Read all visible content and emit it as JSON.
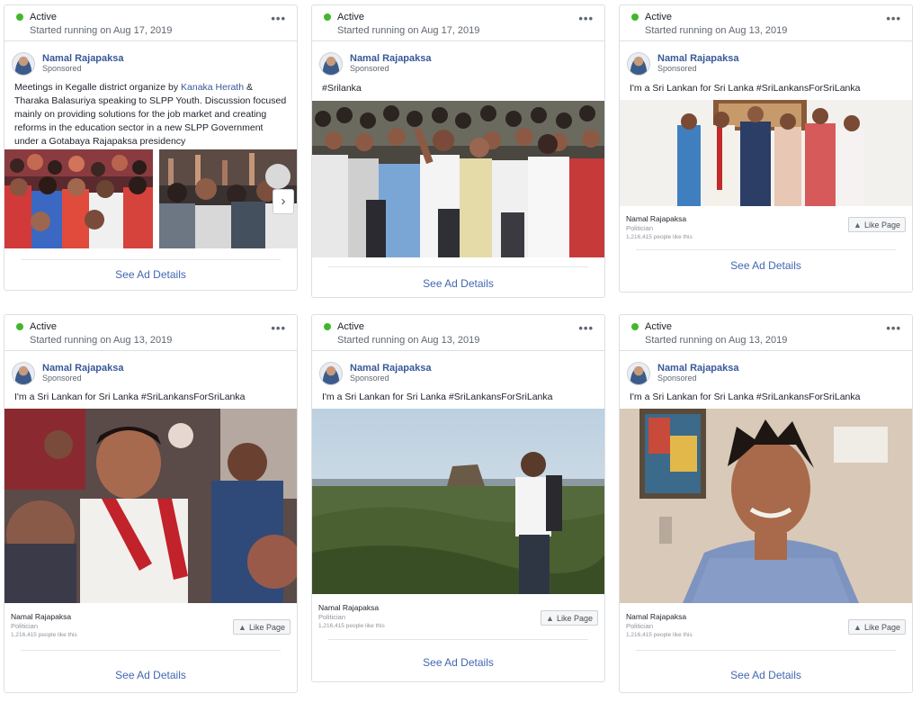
{
  "cards": [
    {
      "status": "Active",
      "started": "Started running on Aug 17, 2019",
      "poster": "Namal Rajapaksa",
      "sponsored": "Sponsored",
      "text_parts": [
        "Meetings in Kegalle district organize by ",
        "Kanaka Herath",
        " & Tharaka Balasuriya speaking to SLPP Youth. Discussion focused mainly on providing solutions for the job market and creating reforms in the education sector in a new SLPP Government under a Gotabaya Rajapaksa presidency"
      ],
      "see_details": "See Ad Details"
    },
    {
      "status": "Active",
      "started": "Started running on Aug 17, 2019",
      "poster": "Namal Rajapaksa",
      "sponsored": "Sponsored",
      "text": "#Srilanka",
      "see_details": "See Ad Details"
    },
    {
      "status": "Active",
      "started": "Started running on Aug 13, 2019",
      "poster": "Namal Rajapaksa",
      "sponsored": "Sponsored",
      "text": "I'm a Sri Lankan for Sri Lanka #SriLankansForSriLanka",
      "page_name": "Namal Rajapaksa",
      "page_category": "Politician",
      "page_likes": "1,216,415 people like this",
      "like_label": "Like Page",
      "see_details": "See Ad Details"
    },
    {
      "status": "Active",
      "started": "Started running on Aug 13, 2019",
      "poster": "Namal Rajapaksa",
      "sponsored": "Sponsored",
      "text": "I'm a Sri Lankan for Sri Lanka #SriLankansForSriLanka",
      "page_name": "Namal Rajapaksa",
      "page_category": "Politician",
      "page_likes": "1,216,415 people like this",
      "like_label": "Like Page",
      "see_details": "See Ad Details"
    },
    {
      "status": "Active",
      "started": "Started running on Aug 13, 2019",
      "poster": "Namal Rajapaksa",
      "sponsored": "Sponsored",
      "text": "I'm a Sri Lankan for Sri Lanka #SriLankansForSriLanka",
      "page_name": "Namal Rajapaksa",
      "page_category": "Politician",
      "page_likes": "1,216,415 people like this",
      "like_label": "Like Page",
      "see_details": "See Ad Details"
    },
    {
      "status": "Active",
      "started": "Started running on Aug 13, 2019",
      "poster": "Namal Rajapaksa",
      "sponsored": "Sponsored",
      "text": "I'm a Sri Lankan for Sri Lanka #SriLankansForSriLanka",
      "page_name": "Namal Rajapaksa",
      "page_category": "Politician",
      "page_likes": "1,216,415 people like this",
      "like_label": "Like Page",
      "see_details": "See Ad Details"
    }
  ],
  "colors": {
    "active_dot": "#42b72a",
    "link": "#385898",
    "see_details": "#4267b2",
    "border": "#dddfe2"
  },
  "icons": [
    "more-icon",
    "thumbs-up-icon",
    "chevron-right-icon"
  ]
}
